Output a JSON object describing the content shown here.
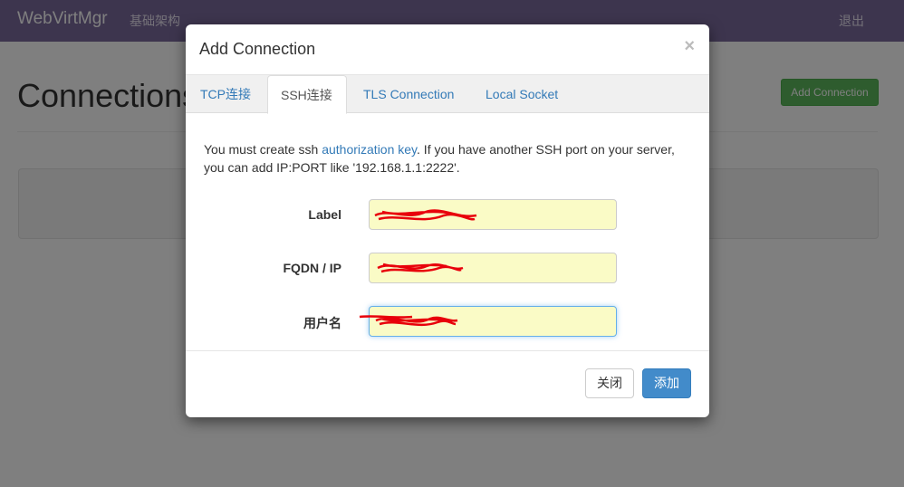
{
  "navbar": {
    "brand": "WebVirtMgr",
    "infra_link": "基础架构",
    "logout_link": "退出"
  },
  "page": {
    "title": "Connections",
    "add_button": "Add Connection"
  },
  "modal": {
    "title": "Add Connection",
    "close_symbol": "×",
    "tabs": [
      {
        "label": "TCP连接",
        "active": false
      },
      {
        "label": "SSH连接",
        "active": true
      },
      {
        "label": "TLS Connection",
        "active": false
      },
      {
        "label": "Local Socket",
        "active": false
      }
    ],
    "help": {
      "prefix": "You must create ssh ",
      "link": "authorization key",
      "suffix": ". If you have another SSH port on your server, you can add IP:PORT like '192.168.1.1:2222'."
    },
    "fields": {
      "label": {
        "label": "Label",
        "value": ""
      },
      "fqdn": {
        "label": "FQDN / IP",
        "value": ""
      },
      "username": {
        "label": "用户名",
        "value": ""
      }
    },
    "buttons": {
      "close": "关闭",
      "add": "添加"
    }
  },
  "colors": {
    "navbar": "#7b6a9d",
    "success": "#5cb85c",
    "primary": "#428bca",
    "input_autofill": "#fafbc6",
    "redaction": "#e8000b"
  }
}
